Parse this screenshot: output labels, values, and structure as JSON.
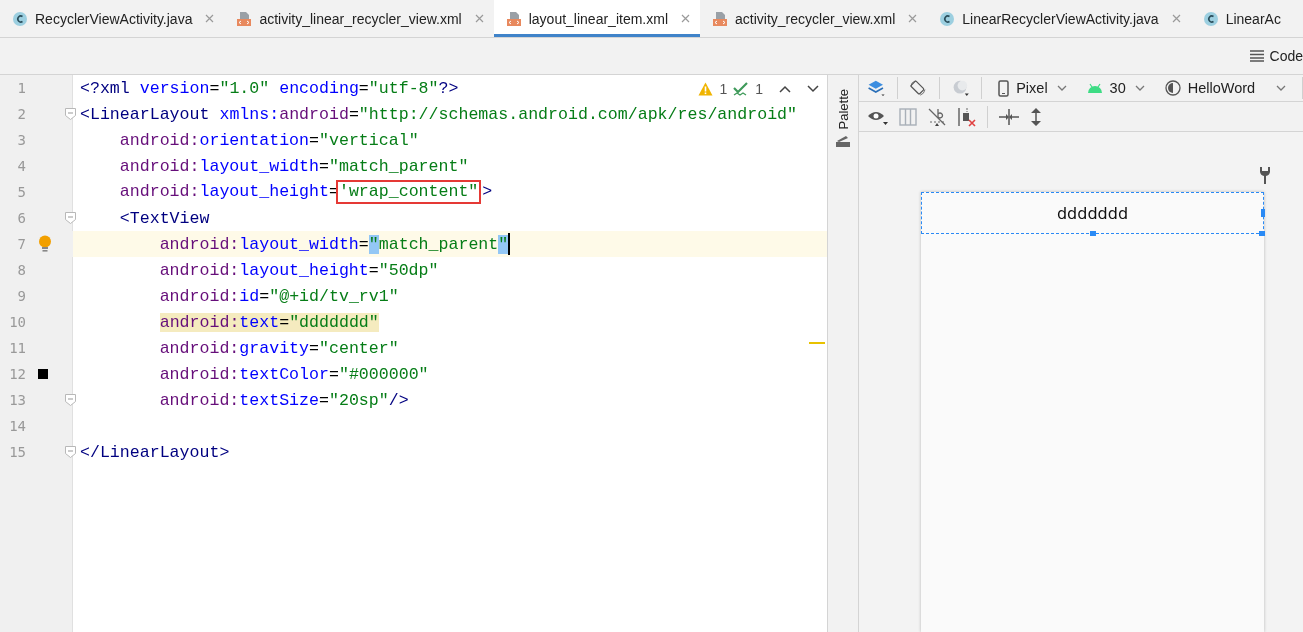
{
  "tabs": [
    {
      "label": "RecyclerViewActivity.java",
      "kind": "java",
      "selected": false,
      "closable": true
    },
    {
      "label": "activity_linear_recycler_view.xml",
      "kind": "xml",
      "selected": false,
      "closable": true
    },
    {
      "label": "layout_linear_item.xml",
      "kind": "xml",
      "selected": true,
      "closable": true
    },
    {
      "label": "activity_recycler_view.xml",
      "kind": "xml",
      "selected": false,
      "closable": true
    },
    {
      "label": "LinearRecyclerViewActivity.java",
      "kind": "java",
      "selected": false,
      "closable": true
    },
    {
      "label": "LinearAc",
      "kind": "java",
      "selected": false,
      "closable": false
    }
  ],
  "view_mode": {
    "label": "Code"
  },
  "inspections": {
    "warnings": "1",
    "weak_warnings": "1"
  },
  "editor": {
    "lines": [
      {
        "number": "1",
        "fold": false,
        "current": false,
        "tokens": [
          {
            "kind": "tag",
            "text": "<?xml "
          },
          {
            "kind": "attr",
            "text": "version"
          },
          {
            "kind": "punct",
            "text": "="
          },
          {
            "kind": "str",
            "text": "\"1.0\""
          },
          {
            "kind": "attr",
            "text": " encoding"
          },
          {
            "kind": "punct",
            "text": "="
          },
          {
            "kind": "str",
            "text": "\"utf-8\""
          },
          {
            "kind": "tag",
            "text": "?>"
          }
        ]
      },
      {
        "number": "2",
        "fold": true,
        "current": false,
        "tokens": [
          {
            "kind": "tag",
            "text": "<LinearLayout "
          },
          {
            "kind": "attr",
            "text": "xmlns:"
          },
          {
            "kind": "ns",
            "text": "android"
          },
          {
            "kind": "punct",
            "text": "="
          },
          {
            "kind": "str",
            "text": "\"http://schemas.android.com/apk/res/android\""
          }
        ]
      },
      {
        "number": "3",
        "fold": false,
        "current": false,
        "tokens": [
          {
            "kind": "ns",
            "text": "    android:"
          },
          {
            "kind": "attr",
            "text": "orientation"
          },
          {
            "kind": "punct",
            "text": "="
          },
          {
            "kind": "str",
            "text": "\"vertical\""
          }
        ]
      },
      {
        "number": "4",
        "fold": false,
        "current": false,
        "tokens": [
          {
            "kind": "ns",
            "text": "    android:"
          },
          {
            "kind": "attr",
            "text": "layout_width"
          },
          {
            "kind": "punct",
            "text": "="
          },
          {
            "kind": "str",
            "text": "\"match_parent\""
          }
        ]
      },
      {
        "number": "5",
        "fold": false,
        "current": false,
        "tokens": [
          {
            "kind": "ns",
            "text": "    android:"
          },
          {
            "kind": "attr",
            "text": "layout_height"
          },
          {
            "kind": "punct",
            "text": "="
          },
          {
            "kind": "str",
            "text": "'wrap_content\"",
            "boxed": true
          },
          {
            "kind": "tag",
            "text": ">"
          }
        ]
      },
      {
        "number": "6",
        "fold": true,
        "current": false,
        "tokens": [
          {
            "kind": "tag",
            "text": "    <TextView"
          }
        ]
      },
      {
        "number": "7",
        "fold": false,
        "current": true,
        "marker": {
          "kind": "bulb"
        },
        "tokens": [
          {
            "kind": "ns",
            "text": "        android:"
          },
          {
            "kind": "attr",
            "text": "layout_width"
          },
          {
            "kind": "punct",
            "text": "="
          },
          {
            "kind": "str",
            "text": "\"",
            "matched": true
          },
          {
            "kind": "str",
            "text": "match_parent"
          },
          {
            "kind": "str",
            "text": "\"",
            "matched": true
          }
        ]
      },
      {
        "number": "8",
        "fold": false,
        "current": false,
        "tokens": [
          {
            "kind": "ns",
            "text": "        android:"
          },
          {
            "kind": "attr",
            "text": "layout_height"
          },
          {
            "kind": "punct",
            "text": "="
          },
          {
            "kind": "str",
            "text": "\"50dp\""
          }
        ]
      },
      {
        "number": "9",
        "fold": false,
        "current": false,
        "tokens": [
          {
            "kind": "ns",
            "text": "        android:"
          },
          {
            "kind": "attr",
            "text": "id"
          },
          {
            "kind": "punct",
            "text": "="
          },
          {
            "kind": "str",
            "text": "\"@+id/tv_rv1\""
          }
        ]
      },
      {
        "number": "10",
        "fold": false,
        "current": false,
        "tokens": [
          {
            "kind": "ns",
            "text": "        android:",
            "highlighted": true
          },
          {
            "kind": "attr",
            "text": "text",
            "highlighted": true
          },
          {
            "kind": "punct",
            "text": "=",
            "highlighted": true
          },
          {
            "kind": "str",
            "text": "\"ddddddd\"",
            "highlighted": true
          }
        ]
      },
      {
        "number": "11",
        "fold": false,
        "current": false,
        "tokens": [
          {
            "kind": "ns",
            "text": "        android:"
          },
          {
            "kind": "attr",
            "text": "gravity"
          },
          {
            "kind": "punct",
            "text": "="
          },
          {
            "kind": "str",
            "text": "\"center\""
          }
        ]
      },
      {
        "number": "12",
        "fold": false,
        "current": false,
        "marker": {
          "kind": "swatch",
          "color": "#000000"
        },
        "tokens": [
          {
            "kind": "ns",
            "text": "        android:"
          },
          {
            "kind": "attr",
            "text": "textColor"
          },
          {
            "kind": "punct",
            "text": "="
          },
          {
            "kind": "str",
            "text": "\"#000000\""
          }
        ]
      },
      {
        "number": "13",
        "fold": true,
        "current": false,
        "tokens": [
          {
            "kind": "ns",
            "text": "        android:"
          },
          {
            "kind": "attr",
            "text": "textSize"
          },
          {
            "kind": "punct",
            "text": "="
          },
          {
            "kind": "str",
            "text": "\"20sp\""
          },
          {
            "kind": "tag",
            "text": "/>"
          }
        ]
      },
      {
        "number": "14",
        "fold": false,
        "current": false
      },
      {
        "number": "15",
        "fold": true,
        "current": false,
        "tokens": [
          {
            "kind": "tag",
            "text": "</LinearLayout>"
          }
        ]
      }
    ]
  },
  "palette": {
    "label": "Palette"
  },
  "design_toolbar": {
    "device": "Pixel",
    "api": "30",
    "theme": "HelloWord"
  },
  "preview": {
    "text": "ddddddd"
  }
}
